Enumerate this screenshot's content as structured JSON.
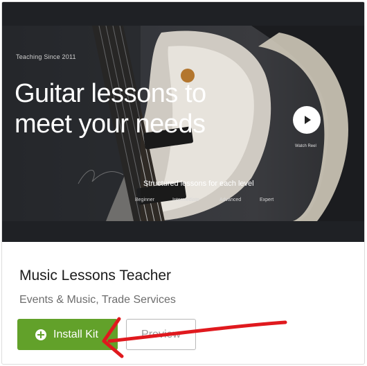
{
  "hero": {
    "tagline": "Teaching Since 2011",
    "headline": "Guitar lessons to meet your needs",
    "subline": "Structured lessons for each level",
    "levels": [
      "Beginner",
      "Intermediate",
      "Advanced",
      "Expert"
    ],
    "watch_label": "Watch Reel",
    "play_icon": "play-icon"
  },
  "card": {
    "title": "Music Lessons Teacher",
    "categories": "Events & Music, Trade Services"
  },
  "actions": {
    "install_label": "Install Kit",
    "install_icon": "plus-circle-icon",
    "preview_label": "Preview"
  },
  "colors": {
    "install_green": "#62a12a",
    "annotation_red": "#e0191e"
  }
}
